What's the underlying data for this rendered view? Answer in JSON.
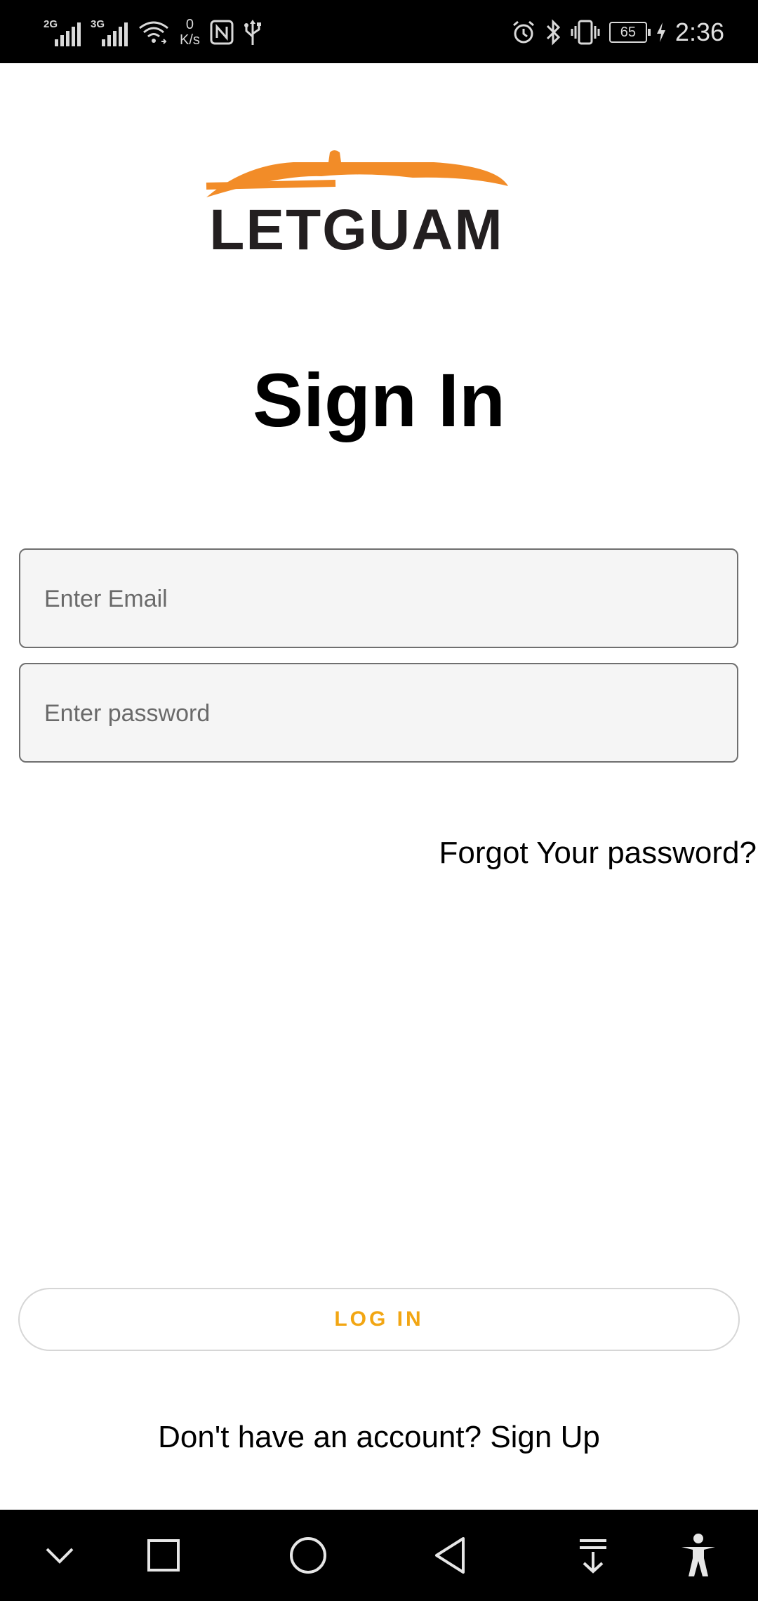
{
  "status_bar": {
    "signal1_tag": "2G",
    "signal2_tag": "3G",
    "net_speed_value": "0",
    "net_speed_unit": "K/s",
    "battery_level": "65",
    "time": "2:36",
    "icons": [
      "signal-icon",
      "signal-icon",
      "wifi-icon",
      "nfc-icon",
      "usb-icon",
      "alarm-icon",
      "bluetooth-icon",
      "vibrate-icon",
      "battery-icon",
      "charging-icon"
    ]
  },
  "logo": {
    "text": "LETGUAM",
    "accent_color": "#f28c28",
    "text_color": "#231f20"
  },
  "page": {
    "title": "Sign In"
  },
  "form": {
    "email_placeholder": "Enter Email",
    "email_value": "",
    "password_placeholder": "Enter password",
    "password_value": "",
    "forgot_link": "Forgot Your password?",
    "login_button": "LOG IN",
    "signup_prompt": "Don't have an account? Sign Up"
  },
  "colors": {
    "accent": "#f2a613",
    "field_background": "#f5f5f5",
    "field_border": "#6f6f6f"
  },
  "nav_bar": {
    "icons": [
      "chevron-down-icon",
      "recents-square-icon",
      "home-circle-icon",
      "back-triangle-icon",
      "notification-pull-icon",
      "accessibility-icon"
    ]
  }
}
